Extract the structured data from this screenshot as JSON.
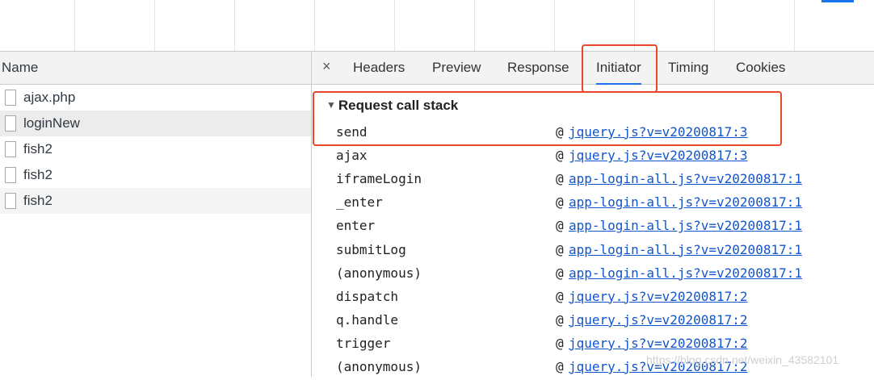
{
  "list": {
    "header": "Name",
    "rows": [
      "ajax.php",
      "loginNew",
      "fish2",
      "fish2",
      "fish2"
    ]
  },
  "tabs": {
    "close": "×",
    "items": [
      "Headers",
      "Preview",
      "Response",
      "Initiator",
      "Timing",
      "Cookies"
    ],
    "active": "Initiator"
  },
  "initiator": {
    "section_title": "Request call stack",
    "at_symbol": "@",
    "frames": [
      {
        "fn": "send",
        "loc": "jquery.js?v=v20200817:3"
      },
      {
        "fn": "ajax",
        "loc": "jquery.js?v=v20200817:3"
      },
      {
        "fn": "iframeLogin",
        "loc": "app-login-all.js?v=v20200817:1"
      },
      {
        "fn": "_enter",
        "loc": "app-login-all.js?v=v20200817:1"
      },
      {
        "fn": "enter",
        "loc": "app-login-all.js?v=v20200817:1"
      },
      {
        "fn": "submitLog",
        "loc": "app-login-all.js?v=v20200817:1"
      },
      {
        "fn": "(anonymous)",
        "loc": "app-login-all.js?v=v20200817:1"
      },
      {
        "fn": "dispatch",
        "loc": "jquery.js?v=v20200817:2"
      },
      {
        "fn": "q.handle",
        "loc": "jquery.js?v=v20200817:2"
      },
      {
        "fn": "trigger",
        "loc": "jquery.js?v=v20200817:2"
      },
      {
        "fn": "(anonymous)",
        "loc": "jquery.js?v=v20200817:2"
      }
    ]
  },
  "watermark": "https://blog.csdn.net/weixin_43582101",
  "colors": {
    "link": "#1155cc",
    "highlight": "#e8472a",
    "active_tab": "#1a73e8"
  }
}
